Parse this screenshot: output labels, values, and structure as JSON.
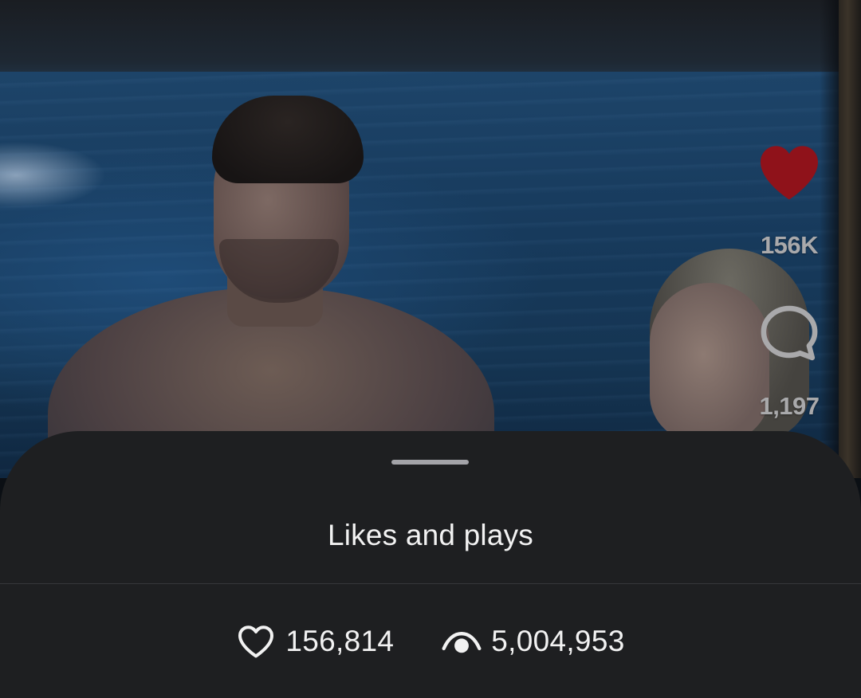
{
  "video": {
    "description_icon": "video-frame"
  },
  "actions": {
    "like": {
      "icon": "heart-filled-icon",
      "count": "156K",
      "color": "#8f121a"
    },
    "comment": {
      "icon": "comment-bubble-icon",
      "count": "1,197"
    }
  },
  "sheet": {
    "title": "Likes and plays",
    "stats": {
      "likes": {
        "icon": "heart-outline-icon",
        "value": "156,814"
      },
      "plays": {
        "icon": "eye-icon",
        "value": "5,004,953"
      }
    },
    "background": "#1e1f21"
  }
}
